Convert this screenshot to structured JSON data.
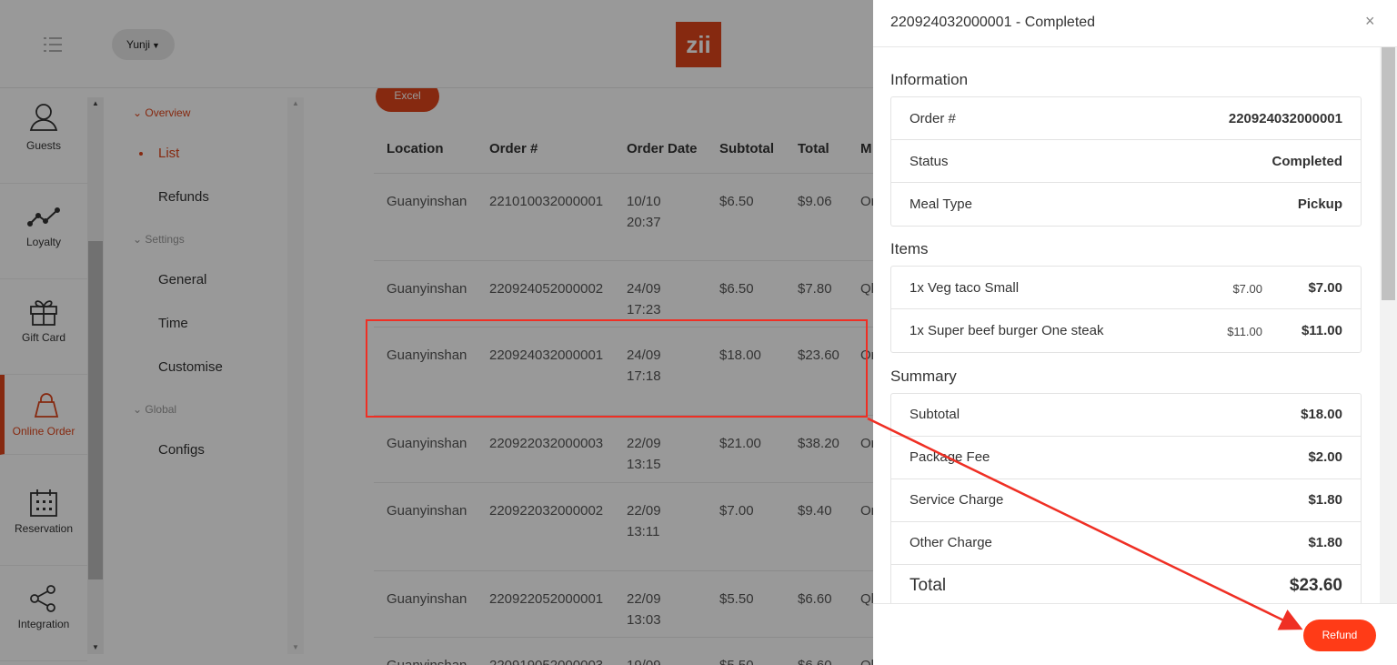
{
  "header": {
    "user_name": "Yunji",
    "logo_text": "zii"
  },
  "nav": {
    "items": [
      {
        "label": "Guests",
        "icon": "user-icon"
      },
      {
        "label": "Loyalty",
        "icon": "trend-icon"
      },
      {
        "label": "Gift Card",
        "icon": "gift-icon"
      },
      {
        "label": "Online Order",
        "icon": "bag-icon",
        "active": true
      },
      {
        "label": "Reservation",
        "icon": "calendar-icon"
      },
      {
        "label": "Integration",
        "icon": "share-icon"
      }
    ]
  },
  "submenu": {
    "overview": "Overview",
    "list": "List",
    "refunds": "Refunds",
    "settings": "Settings",
    "general": "General",
    "time": "Time",
    "customise": "Customise",
    "global": "Global",
    "configs": "Configs"
  },
  "table": {
    "excel_label": "Excel",
    "headers": [
      "Location",
      "Order #",
      "Order Date",
      "Subtotal",
      "Total",
      "M"
    ],
    "rows": [
      {
        "location": "Guanyinshan",
        "order": "221010032000001",
        "date": "10/10",
        "time": "20:37",
        "subtotal": "$6.50",
        "total": "$9.06",
        "m": "Or"
      },
      {
        "location": "Guanyinshan",
        "order": "220924052000002",
        "date": "24/09",
        "time": "17:23",
        "subtotal": "$6.50",
        "total": "$7.80",
        "m": "Ql"
      },
      {
        "location": "Guanyinshan",
        "order": "220924032000001",
        "date": "24/09",
        "time": "17:18",
        "subtotal": "$18.00",
        "total": "$23.60",
        "m": "Or"
      },
      {
        "location": "Guanyinshan",
        "order": "220922032000003",
        "date": "22/09",
        "time": "13:15",
        "subtotal": "$21.00",
        "total": "$38.20",
        "m": "Or"
      },
      {
        "location": "Guanyinshan",
        "order": "220922032000002",
        "date": "22/09",
        "time": "13:11",
        "subtotal": "$7.00",
        "total": "$9.40",
        "m": "Or"
      },
      {
        "location": "Guanyinshan",
        "order": "220922052000001",
        "date": "22/09",
        "time": "13:03",
        "subtotal": "$5.50",
        "total": "$6.60",
        "m": "Ql"
      },
      {
        "location": "Guanyinshan",
        "order": "220919052000003",
        "date": "19/09",
        "time": "",
        "subtotal": "$5.50",
        "total": "$6.60",
        "m": "Ql"
      }
    ]
  },
  "drawer": {
    "title": "220924032000001 - Completed",
    "close": "×",
    "information_title": "Information",
    "info": [
      {
        "label": "Order #",
        "value": "220924032000001"
      },
      {
        "label": "Status",
        "value": "Completed"
      },
      {
        "label": "Meal Type",
        "value": "Pickup"
      }
    ],
    "items_title": "Items",
    "items": [
      {
        "label": "1x Veg taco Small",
        "unit": "$7.00",
        "value": "$7.00"
      },
      {
        "label": "1x Super beef burger One steak",
        "unit": "$11.00",
        "value": "$11.00"
      }
    ],
    "summary_title": "Summary",
    "summary": [
      {
        "label": "Subtotal",
        "value": "$18.00"
      },
      {
        "label": "Package Fee",
        "value": "$2.00"
      },
      {
        "label": "Service Charge",
        "value": "$1.80"
      },
      {
        "label": "Other Charge",
        "value": "$1.80"
      },
      {
        "label": "Total",
        "value": "$23.60"
      }
    ],
    "refund_label": "Refund"
  },
  "colors": {
    "accent": "#e0451b",
    "refund": "#ff3b17",
    "annotation": "#ef2f24"
  }
}
